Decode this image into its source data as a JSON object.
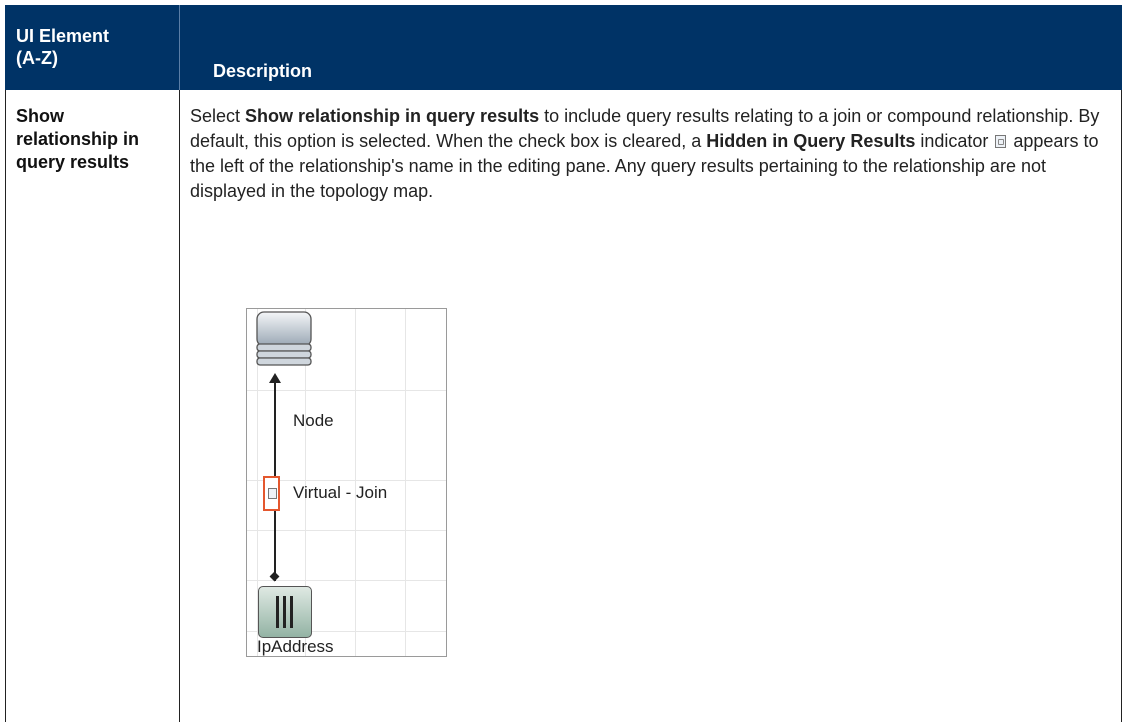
{
  "table": {
    "header": {
      "col1": "UI Element (A-Z)",
      "col2": "Description"
    },
    "row": {
      "term": "Show relationship in query results",
      "desc": {
        "p1": "Select ",
        "b1": "Show relationship in query results",
        "p2": " to include query results relating to a join or compound relationship. By default, this option is selected. When the check box is cleared, a ",
        "b2": "Hidden in Query Results",
        "p3": " indicator ",
        "p4": " appears to the left of the relationship's name in the editing pane. Any query results pertaining to the relationship are not displayed in the topology map."
      }
    }
  },
  "figure": {
    "node_label": "Node",
    "edge_label": "Virtual - Join",
    "ip_label": "IpAddress"
  },
  "colors": {
    "header_bg": "#003366",
    "header_text": "#ffffff",
    "hidden_frame": "#e4572e"
  },
  "icons": [
    "hidden-in-query-results-icon",
    "database-node-icon",
    "ip-address-icon",
    "arrow-head-icon"
  ]
}
